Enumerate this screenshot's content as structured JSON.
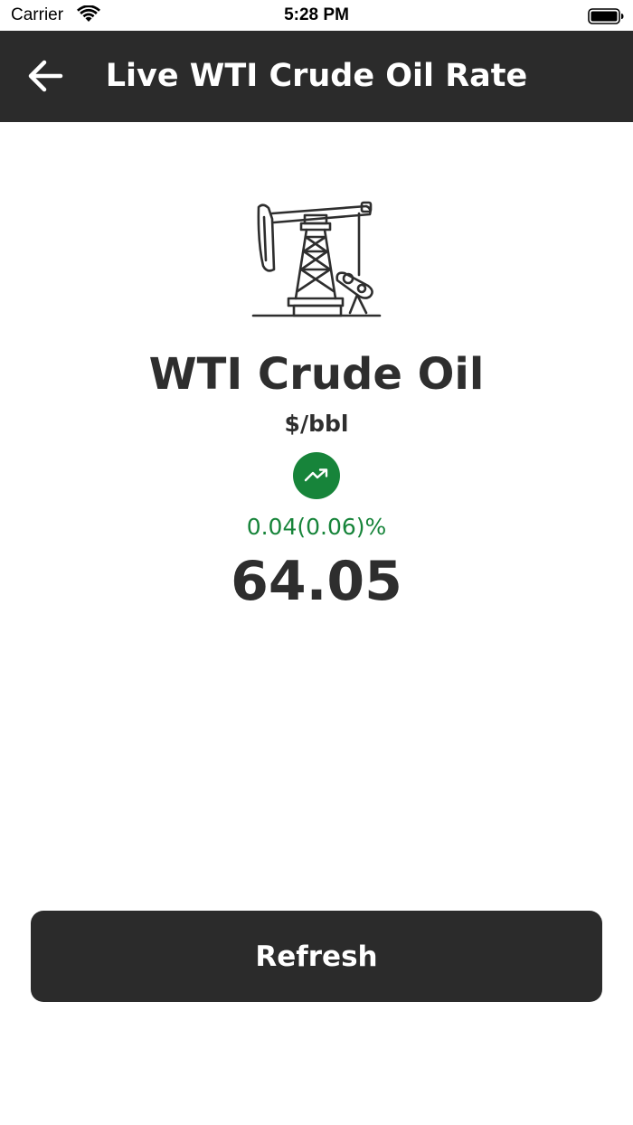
{
  "status_bar": {
    "carrier": "Carrier",
    "time": "5:28 PM",
    "wifi_icon": "wifi-icon",
    "battery_icon": "battery-icon"
  },
  "nav_bar": {
    "title": "Live WTI Crude Oil Rate",
    "back_icon": "arrow-left-icon",
    "background": "#2b2b2b"
  },
  "commodity": {
    "icon": "oil-pumpjack-icon",
    "name": "WTI Crude Oil",
    "unit": "$/bbl",
    "trend_icon": "trending-up-icon",
    "trend_color": "#17843a",
    "change": "0.04(0.06)%",
    "price": "64.05"
  },
  "actions": {
    "refresh_label": "Refresh"
  }
}
